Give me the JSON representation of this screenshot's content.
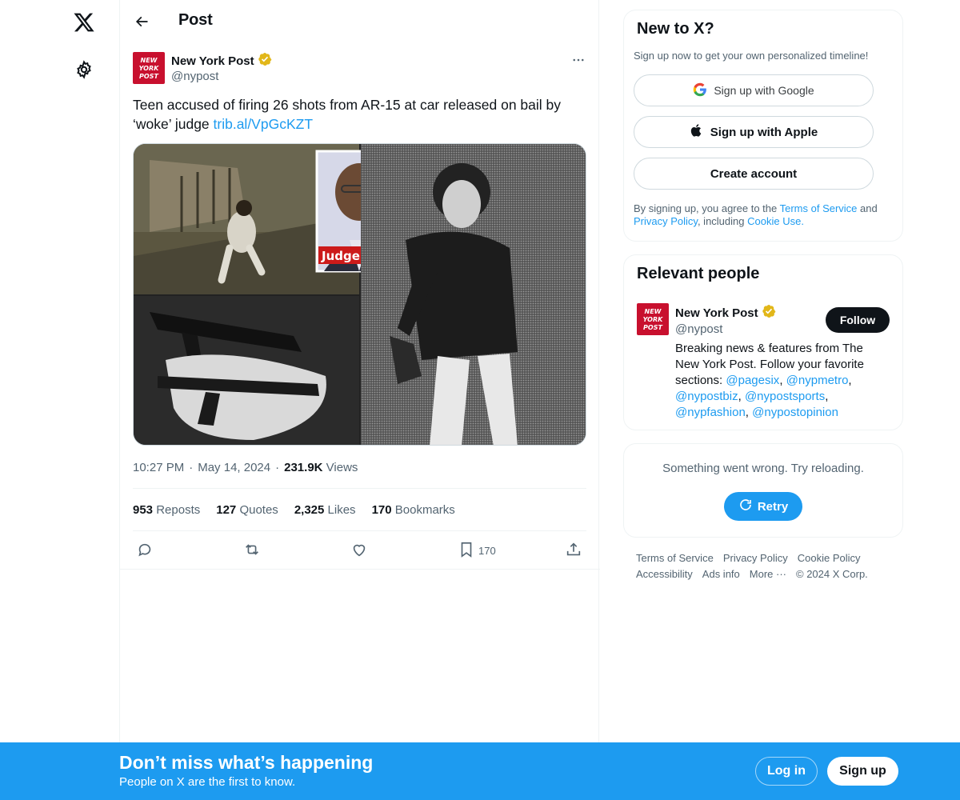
{
  "colors": {
    "accent": "#1d9bf0",
    "text": "#0f1419",
    "muted": "#536471",
    "verified": "#e2b719",
    "brand_red": "#c8102e"
  },
  "header": {
    "title": "Post",
    "back_icon": "arrow-left-icon"
  },
  "nav": {
    "logo_icon": "x-logo-icon",
    "settings_icon": "gear-icon"
  },
  "post": {
    "author_name": "New York Post",
    "author_handle": "@nypost",
    "avatar_text": [
      "NEW",
      "YORK",
      "POST"
    ],
    "text": "Teen accused of firing 26 shots from AR-15 at car released on bail by ‘woke’ judge ",
    "link": "trib.al/VpGcKZT",
    "media_label": "Judge",
    "time": "10:27 PM",
    "date": "May 14, 2024",
    "views_count": "231.9K",
    "views_label": "Views",
    "stats": [
      {
        "count": "953",
        "label": "Reposts"
      },
      {
        "count": "127",
        "label": "Quotes"
      },
      {
        "count": "2,325",
        "label": "Likes"
      },
      {
        "count": "170",
        "label": "Bookmarks"
      }
    ],
    "bookmark_count": "170"
  },
  "signup_card": {
    "title": "New to X?",
    "subtitle": "Sign up now to get your own personalized timeline!",
    "google": "Sign up with Google",
    "apple": "Sign up with Apple",
    "create": "Create account",
    "legal_1": "By signing up, you agree to the ",
    "terms": "Terms of Service",
    "legal_2": " and ",
    "privacy": "Privacy Policy",
    "legal_3": ", including ",
    "cookie": "Cookie Use",
    "legal_4": "."
  },
  "relevant": {
    "title": "Relevant people",
    "name": "New York Post",
    "handle": "@nypost",
    "follow": "Follow",
    "bio_1": "Breaking news & features from The New York Post. Follow your favorite sections: ",
    "mentions": [
      "@pagesix",
      "@nypmetro",
      "@nypostbiz",
      "@nypostsports",
      "@nypfashion",
      "@nypostopinion"
    ]
  },
  "error_card": {
    "message": "Something went wrong. Try reloading.",
    "retry": "Retry"
  },
  "footer": {
    "links": [
      "Terms of Service",
      "Privacy Policy",
      "Cookie Policy",
      "Accessibility",
      "Ads info",
      "More ···"
    ],
    "copyright": "© 2024 X Corp."
  },
  "banner": {
    "title": "Don’t miss what’s happening",
    "subtitle": "People on X are the first to know.",
    "login": "Log in",
    "signup": "Sign up"
  }
}
